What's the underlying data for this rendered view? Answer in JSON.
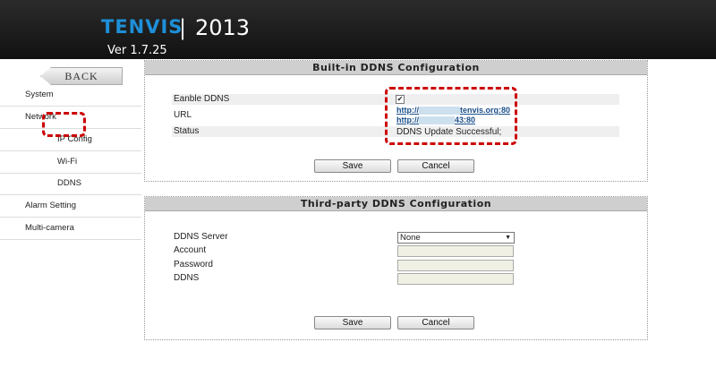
{
  "header": {
    "brand": "TENVIS",
    "separator": "|",
    "year": "2013",
    "version": "Ver 1.7.25"
  },
  "sidebar": {
    "back_label": "BACK",
    "items": [
      {
        "label": "System"
      },
      {
        "label": "Network"
      },
      {
        "label": "IP Config"
      },
      {
        "label": "Wi-Fi"
      },
      {
        "label": "DDNS"
      },
      {
        "label": "Alarm Setting"
      },
      {
        "label": "Multi-camera"
      }
    ]
  },
  "builtin": {
    "title": "Built-in DDNS Configuration",
    "enable_label": "Eanble DDNS",
    "enable_checked": true,
    "url_label": "URL",
    "url_line1_prefix": "http://",
    "url_line1_suffix": "tenvis.org:80",
    "url_line2_prefix": "http://",
    "url_line2_suffix": "43:80",
    "status_label": "Status",
    "status_value": "DDNS Update Successful;",
    "save_label": "Save",
    "cancel_label": "Cancel"
  },
  "thirdparty": {
    "title": "Third-party DDNS Configuration",
    "server_label": "DDNS Server",
    "server_value": "None",
    "account_label": "Account",
    "password_label": "Password",
    "ddns_label": "DDNS",
    "save_label": "Save",
    "cancel_label": "Cancel"
  }
}
